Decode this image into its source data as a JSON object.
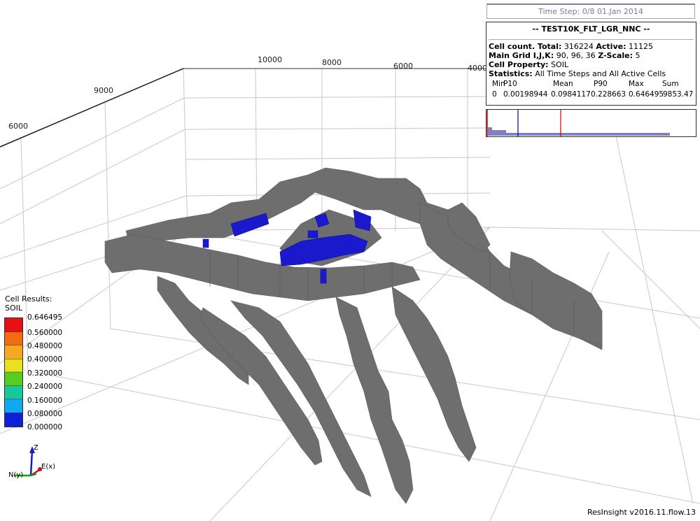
{
  "timestep": "Time Step: 0/8 01.Jan 2014",
  "info": {
    "title": "-- TEST10K_FLT_LGR_NNC --",
    "cell_count_label": "Cell count. Total:",
    "cell_count_total": "316224",
    "active_label": "Active:",
    "active_value": "11125",
    "main_grid_label": "Main Grid I,J,K:",
    "main_grid_value": "90, 96, 36",
    "zscale_label": "Z-Scale:",
    "zscale_value": "5",
    "cell_property_label": "Cell Property:",
    "cell_property_value": "SOIL",
    "statistics_label": "Statistics:",
    "statistics_value": "All Time Steps and All Active Cells",
    "stats_headers": [
      "Min",
      "P10",
      "Mean",
      "P90",
      "Max",
      "Sum"
    ],
    "stats_values": [
      "0",
      "0.00198944",
      "0.0984117",
      "0.228663",
      "0.646495",
      "9853.47"
    ]
  },
  "histogram_colors": {
    "p10": "#0000cc",
    "p90": "#cc0000",
    "bars": "#8080c0"
  },
  "axis_ticks": {
    "top": [
      "10000",
      "8000",
      "6000",
      "4000"
    ],
    "left": [
      "9000",
      "6000"
    ]
  },
  "legend": {
    "title_line1": "Cell Results:",
    "title_line2": "SOIL",
    "ticks": [
      "0.646495",
      "0.560000",
      "0.480000",
      "0.400000",
      "0.320000",
      "0.240000",
      "0.160000",
      "0.080000",
      "0.000000"
    ]
  },
  "gizmo": {
    "z": "Z",
    "x": "E(x)",
    "y": "N(y)"
  },
  "colors": {
    "surface": "#6e6e6e",
    "highlight": "#1a1acc",
    "grid": "#c8c8c8"
  },
  "version": "ResInsight v2016.11.flow.13"
}
